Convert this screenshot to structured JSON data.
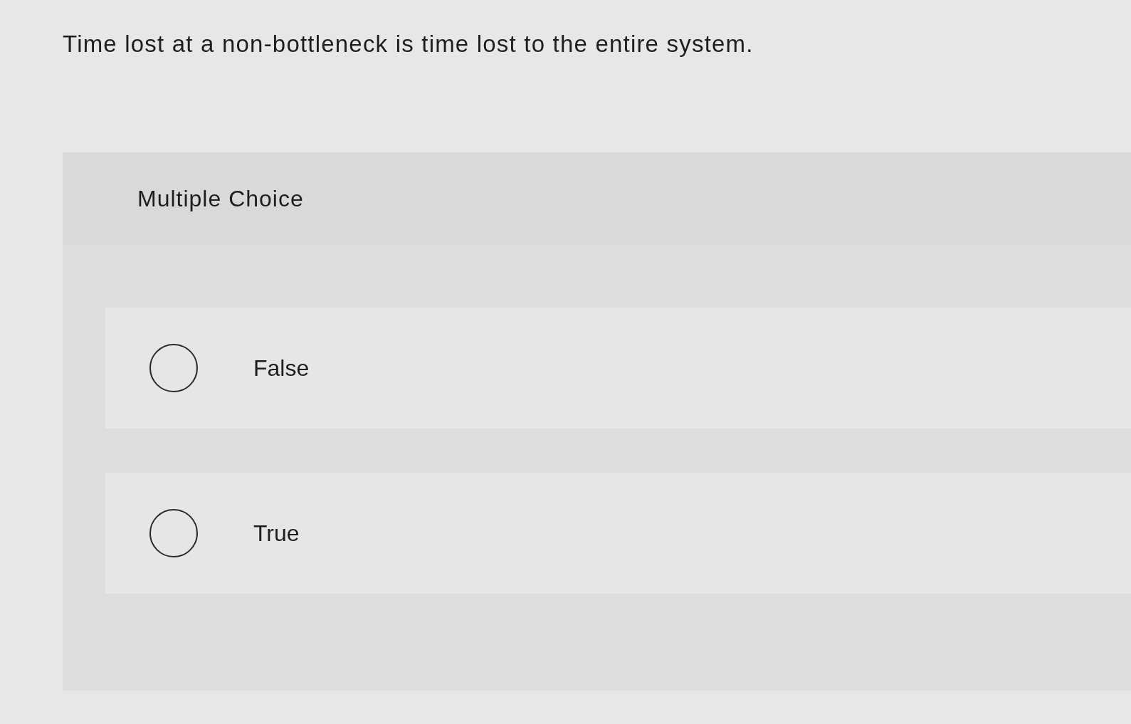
{
  "question": {
    "text": "Time lost at a non-bottleneck is time lost to the entire system."
  },
  "answer_panel": {
    "type_label": "Multiple Choice",
    "options": [
      {
        "label": "False",
        "selected": false
      },
      {
        "label": "True",
        "selected": false
      }
    ]
  }
}
